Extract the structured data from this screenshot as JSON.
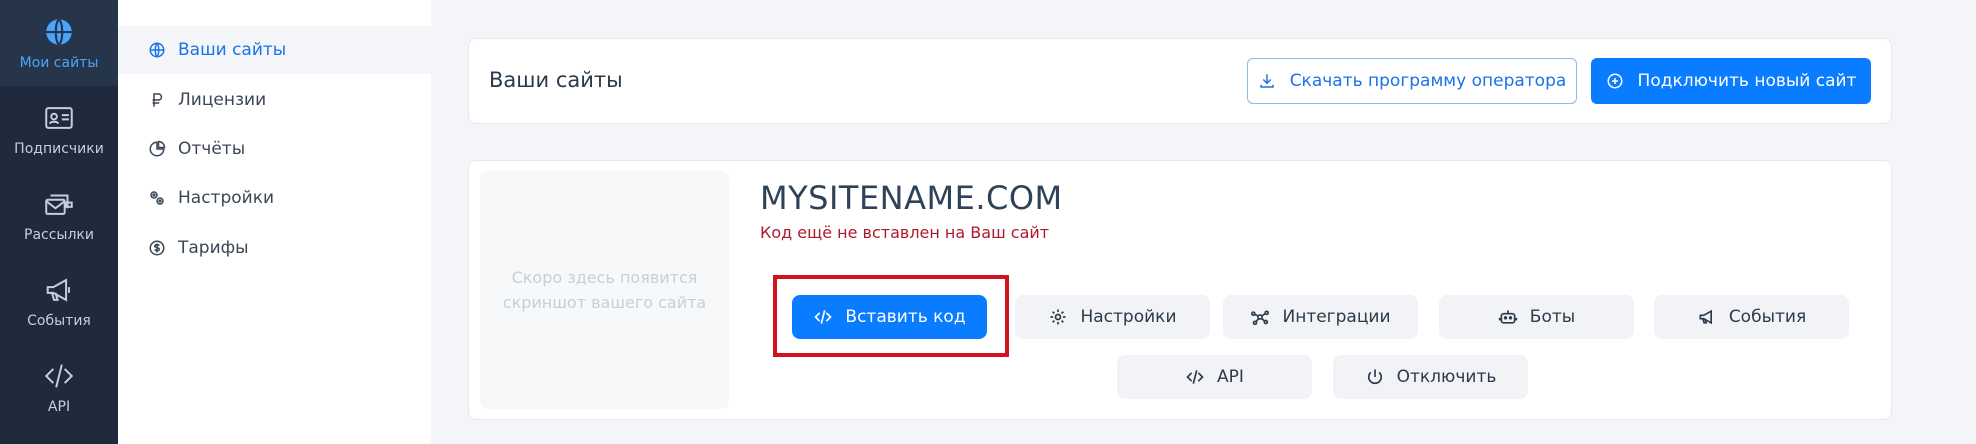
{
  "rail": {
    "items": [
      {
        "label": "Мои сайты",
        "icon": "globe-icon"
      },
      {
        "label": "Подписчики",
        "icon": "contact-card-icon"
      },
      {
        "label": "Рассылки",
        "icon": "mail-stack-icon"
      },
      {
        "label": "События",
        "icon": "megaphone-icon"
      },
      {
        "label": "API",
        "icon": "code-icon"
      }
    ]
  },
  "menu": {
    "items": [
      {
        "label": "Ваши сайты",
        "icon": "globe-icon"
      },
      {
        "label": "Лицензии",
        "icon": "ruble-icon"
      },
      {
        "label": "Отчёты",
        "icon": "pie-chart-icon"
      },
      {
        "label": "Настройки",
        "icon": "gears-icon"
      },
      {
        "label": "Тарифы",
        "icon": "dollar-circle-icon"
      }
    ]
  },
  "header": {
    "title": "Ваши сайты",
    "download_label": "Скачать программу оператора",
    "connect_label": "Подключить новый сайт"
  },
  "site": {
    "screenshot_placeholder": "Скоро здесь появится скриншот вашего сайта",
    "name": "MYSITENAME.COM",
    "status": "Код ещё не вставлен на Ваш сайт",
    "actions": {
      "insert_code": "Вставить код",
      "settings": "Настройки",
      "integrations": "Интеграции",
      "bots": "Боты",
      "events": "События",
      "api": "API",
      "disable": "Отключить"
    }
  },
  "colors": {
    "rail_bg": "#1f2a3c",
    "accent": "#0a7cff",
    "status_error": "#b0182d",
    "highlight": "#d0121f"
  }
}
